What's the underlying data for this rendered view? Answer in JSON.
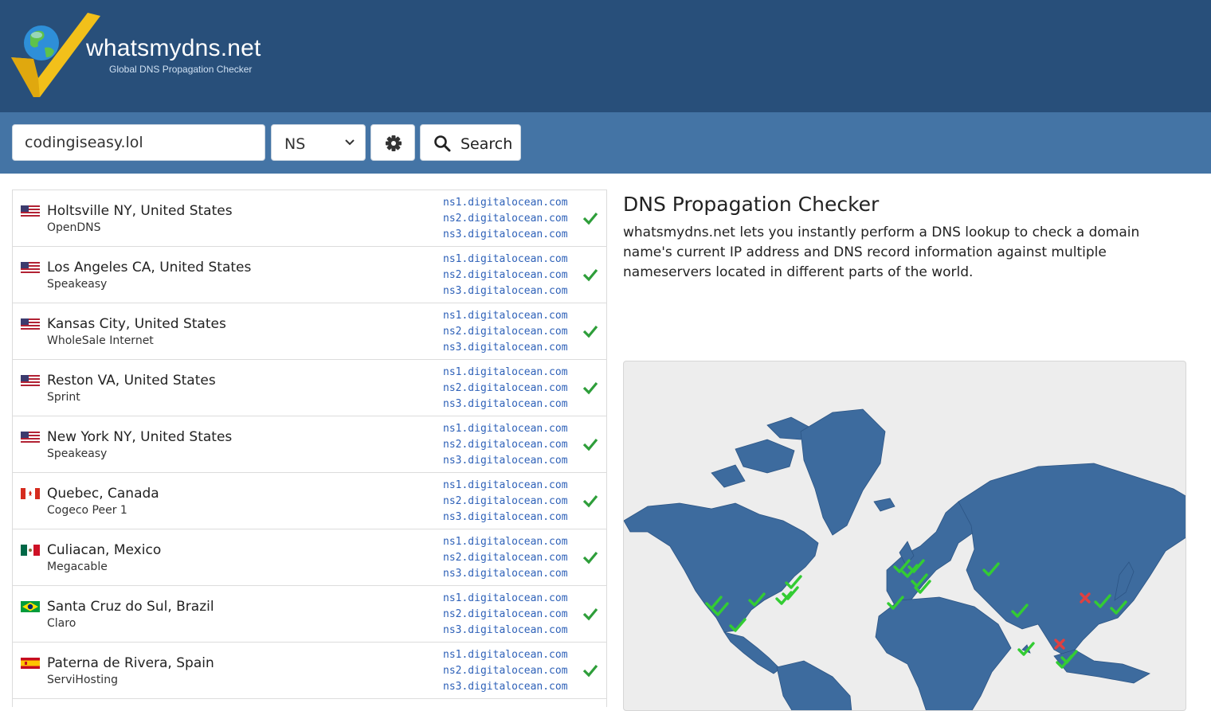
{
  "header": {
    "brand": "whatsmydns.net",
    "tagline": "Global DNS Propagation Checker"
  },
  "search": {
    "domain_value": "codingiseasy.lol",
    "record_type": "NS",
    "button_label": "Search"
  },
  "results": [
    {
      "flag": "us-flag-icon",
      "location": "Holtsville NY, United States",
      "provider": "OpenDNS",
      "ns": [
        "ns1.digitalocean.com",
        "ns2.digitalocean.com",
        "ns3.digitalocean.com"
      ],
      "status": "ok"
    },
    {
      "flag": "us-flag-icon",
      "location": "Los Angeles CA, United States",
      "provider": "Speakeasy",
      "ns": [
        "ns1.digitalocean.com",
        "ns2.digitalocean.com",
        "ns3.digitalocean.com"
      ],
      "status": "ok"
    },
    {
      "flag": "us-flag-icon",
      "location": "Kansas City, United States",
      "provider": "WholeSale Internet",
      "ns": [
        "ns1.digitalocean.com",
        "ns2.digitalocean.com",
        "ns3.digitalocean.com"
      ],
      "status": "ok"
    },
    {
      "flag": "us-flag-icon",
      "location": "Reston VA, United States",
      "provider": "Sprint",
      "ns": [
        "ns1.digitalocean.com",
        "ns2.digitalocean.com",
        "ns3.digitalocean.com"
      ],
      "status": "ok"
    },
    {
      "flag": "us-flag-icon",
      "location": "New York NY, United States",
      "provider": "Speakeasy",
      "ns": [
        "ns1.digitalocean.com",
        "ns2.digitalocean.com",
        "ns3.digitalocean.com"
      ],
      "status": "ok"
    },
    {
      "flag": "ca-flag-icon",
      "location": "Quebec, Canada",
      "provider": "Cogeco Peer 1",
      "ns": [
        "ns1.digitalocean.com",
        "ns2.digitalocean.com",
        "ns3.digitalocean.com"
      ],
      "status": "ok"
    },
    {
      "flag": "mx-flag-icon",
      "location": "Culiacan, Mexico",
      "provider": "Megacable",
      "ns": [
        "ns1.digitalocean.com",
        "ns2.digitalocean.com",
        "ns3.digitalocean.com"
      ],
      "status": "ok"
    },
    {
      "flag": "br-flag-icon",
      "location": "Santa Cruz do Sul, Brazil",
      "provider": "Claro",
      "ns": [
        "ns1.digitalocean.com",
        "ns2.digitalocean.com",
        "ns3.digitalocean.com"
      ],
      "status": "ok"
    },
    {
      "flag": "es-flag-icon",
      "location": "Paterna de Rivera, Spain",
      "provider": "ServiHosting",
      "ns": [
        "ns1.digitalocean.com",
        "ns2.digitalocean.com",
        "ns3.digitalocean.com"
      ],
      "status": "ok"
    }
  ],
  "info": {
    "title": "DNS Propagation Checker",
    "description": "whatsmydns.net lets you instantly perform a DNS lookup to check a domain name's current IP address and DNS record information against multiple nameservers located in different parts of the world."
  },
  "map": {
    "land_color": "#3d6b9e",
    "ok_color": "#33cc33",
    "fail_color": "#e04040"
  }
}
